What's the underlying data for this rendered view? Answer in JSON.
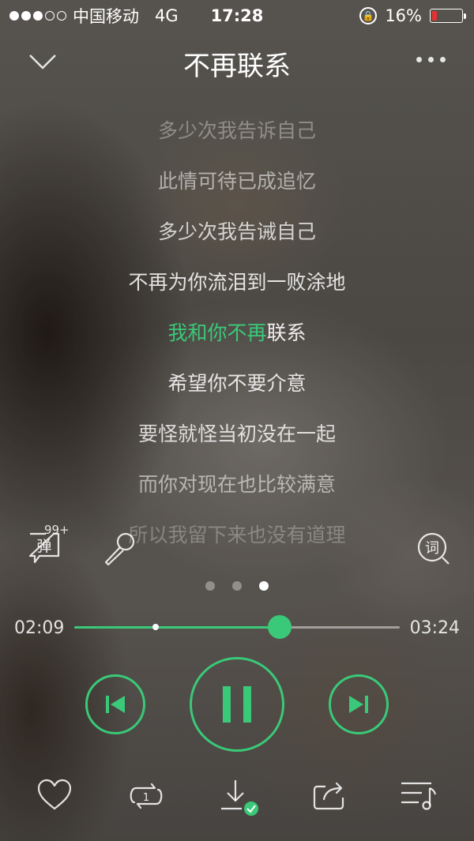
{
  "status_bar": {
    "signal_dots_filled": 3,
    "signal_dots_total": 5,
    "carrier": "中国移动",
    "network": "4G",
    "time": "17:28",
    "battery_text": "16%",
    "battery_level": 0.16
  },
  "header": {
    "title": "不再联系",
    "back_icon": "chevron-down-icon",
    "more_icon": "more-horizontal-icon"
  },
  "lyrics": {
    "lines": [
      "多少次我告诉自己",
      "此情可待已成追忆",
      "多少次我告诫自己",
      "不再为你流泪到一败涂地",
      "我和你不再联系",
      "希望你不要介意",
      "要怪就怪当初没在一起",
      "而你对现在也比较满意",
      "所以我留下来也没有道理"
    ],
    "current_line_sung": "我和你不再",
    "current_line_rest": "联系"
  },
  "side_actions": {
    "danmu_label": "弹",
    "danmu_count": "99+",
    "lyrics_label": "词"
  },
  "pager": {
    "count": 3,
    "active_index": 2
  },
  "progress": {
    "current_time": "02:09",
    "total_time": "03:24",
    "played_fraction": 0.632,
    "buffer_marker_fraction": 0.24
  },
  "controls": {
    "prev_icon": "skip-previous-icon",
    "play_icon": "pause-icon",
    "next_icon": "skip-next-icon"
  },
  "bottom_bar": {
    "repeat_badge": "1",
    "icons": [
      "heart-icon",
      "repeat-one-icon",
      "download-done-icon",
      "share-icon",
      "playlist-icon"
    ]
  },
  "colors": {
    "accent": "#3ac978",
    "battery_low": "#e3322f"
  }
}
